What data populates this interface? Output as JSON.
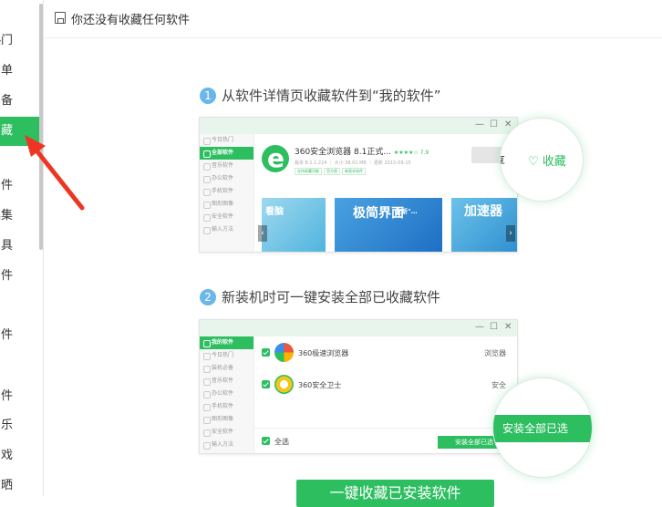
{
  "sidebar": {
    "items": [
      {
        "label": "热门"
      },
      {
        "label": "单"
      },
      {
        "label": "备"
      },
      {
        "label": "藏"
      },
      {
        "label": "件"
      },
      {
        "label": "具集"
      },
      {
        "label": "具"
      },
      {
        "label": "件"
      },
      {
        "label": "件"
      },
      {
        "label": "件"
      },
      {
        "label": "乐"
      },
      {
        "label": "戏"
      },
      {
        "label": "晾晒"
      }
    ],
    "active_index": 3
  },
  "topbar": {
    "message": "你还没有收藏任何软件"
  },
  "step1": {
    "num": "1",
    "title": "从软件详情页收藏软件到“我的软件”"
  },
  "step2": {
    "num": "2",
    "title": "新装机时可一键安装全部已收藏软件"
  },
  "mock1": {
    "side": [
      "今日热门",
      "全部软件",
      "音乐软件",
      "办公软件",
      "手机软件",
      "图形图像",
      "安全软件",
      "输入方法"
    ],
    "active_side": "全部软件",
    "app_name": "360安全浏览器 8.1正式...",
    "app_rating": "★★★★☆ 7.9",
    "app_meta": "版本 8.1.1.224 ｜ 大小 38.01 MB ｜ 更新 2015-09-15",
    "tags": [
      "支持收藏功能",
      "官方版",
      "新版本软件"
    ],
    "shots": [
      "看脑",
      "极简界面",
      "全新\"…",
      "加速器"
    ],
    "prev": "‹",
    "next": "›",
    "zoom_share": "享",
    "zoom_fav": "♡ 收藏"
  },
  "mock2": {
    "side": [
      "我的软件",
      "今日热门",
      "装机必备",
      "音乐软件",
      "办公软件",
      "手机软件",
      "图形图像",
      "安全软件",
      "输入方法"
    ],
    "active_side": "我的软件",
    "rows": [
      {
        "name": "360极速浏览器",
        "category": "浏览器"
      },
      {
        "name": "360安全卫士",
        "category": "安全"
      }
    ],
    "select_all": "全选",
    "install_btn": "安装全部已选",
    "zoom_btn": "安装全部已选",
    "zoom_cat": "安全"
  },
  "cta": {
    "label": "一键收藏已安装软件"
  }
}
